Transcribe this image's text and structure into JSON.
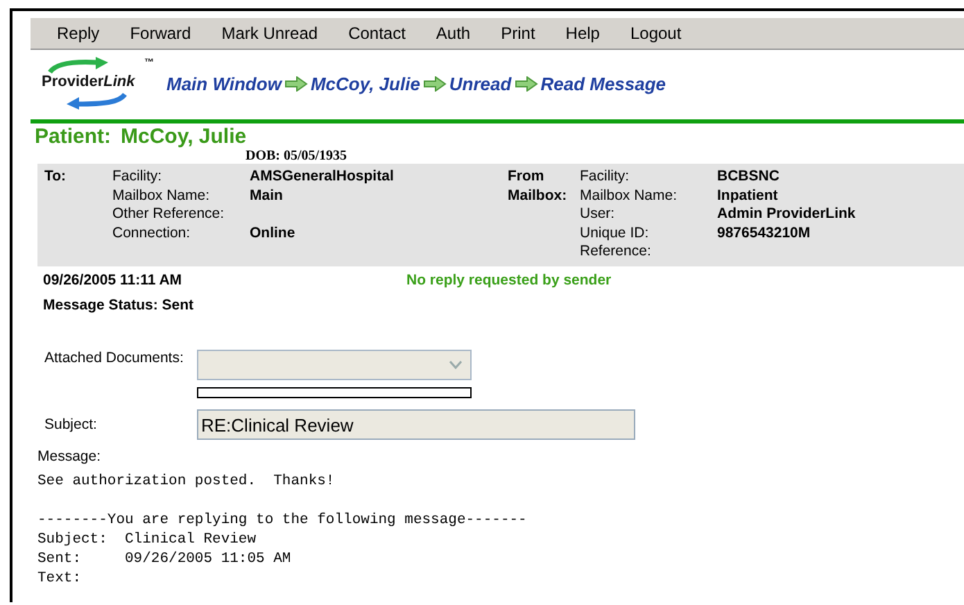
{
  "menu": [
    "Reply",
    "Forward",
    "Mark Unread",
    "Contact",
    "Auth",
    "Print",
    "Help",
    "Logout"
  ],
  "logo": {
    "text": "Provider",
    "text_italic": "Link",
    "mark": "™"
  },
  "breadcrumb": [
    "Main Window",
    "McCoy, Julie",
    "Unread",
    "Read Message"
  ],
  "patient": {
    "label": "Patient:",
    "name": "McCoy, Julie",
    "dob": "DOB: 05/05/1935"
  },
  "to": {
    "heading": "To:",
    "fields": [
      {
        "label": "Facility:",
        "value": "AMSGeneralHospital"
      },
      {
        "label": "Mailbox Name:",
        "value": "Main"
      },
      {
        "label": "Other Reference:"
      },
      {
        "label": "Connection:",
        "value": "Online"
      }
    ]
  },
  "from": {
    "heading": "From Mailbox:",
    "fields": [
      {
        "label": "Facility:",
        "value": "BCBSNC"
      },
      {
        "label": "Mailbox Name:",
        "value": "Inpatient"
      },
      {
        "label": "User:",
        "value": "Admin ProviderLink"
      },
      {
        "label": "Unique ID:",
        "value": "9876543210M"
      },
      {
        "label": "Reference:"
      }
    ]
  },
  "sent_time": "09/26/2005 11:11 AM",
  "reply_note": "No reply requested by sender",
  "status": "Message Status: Sent",
  "attached": {
    "label": "Attached Documents:",
    "disabled": true
  },
  "subject": {
    "label": "Subject:",
    "value": "RE:Clinical Review"
  },
  "message": {
    "label": "Message:",
    "blocks": [
      [
        "See authorization posted.  Thanks!"
      ],
      [
        "--------You are replying to the following message-------",
        "Subject:  Clinical Review",
        "Sent:     09/26/2005 11:05 AM",
        "Text:"
      ]
    ]
  }
}
